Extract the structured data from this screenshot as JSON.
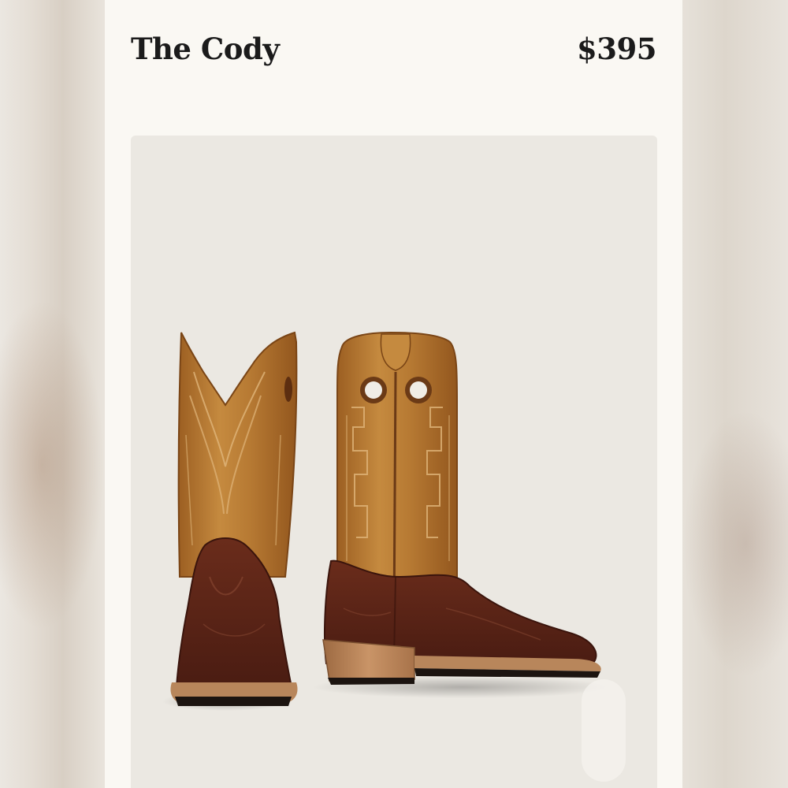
{
  "product": {
    "name": "The Cody",
    "price": "$395"
  },
  "image": {
    "icon": "cowboy-boots-image"
  },
  "colors": {
    "card_background": "#faf8f3",
    "image_background": "#ebe8e2",
    "shaft_leather": "#b9792f",
    "foot_leather": "#5a2417",
    "heel_wood": "#b98356",
    "text": "#1b1b1b"
  }
}
